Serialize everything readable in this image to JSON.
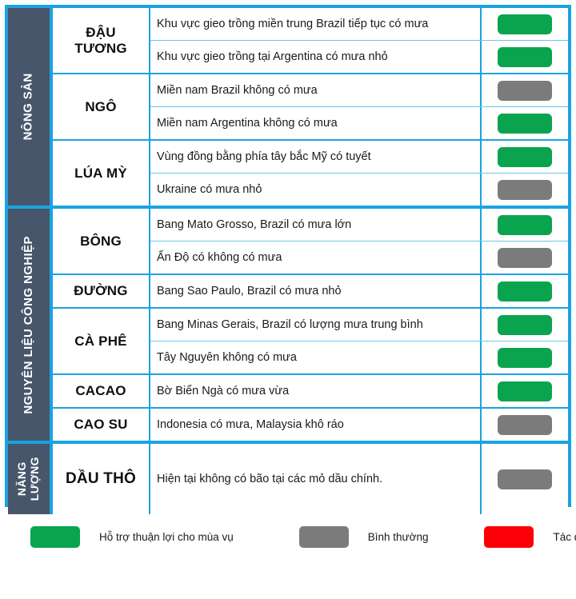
{
  "colors": {
    "border_blue": "#1aa3e0",
    "row_divider": "#6ec6ea",
    "sidebar_slate": "#47566b",
    "status_good": "#0aa44e",
    "status_neutral": "#7b7b7b",
    "status_bad": "#fb0007",
    "page_bg": "#ffffff"
  },
  "sections": [
    {
      "category": "NÔNG SẢN",
      "groups": [
        {
          "commodity": "ĐẬU\nTƯƠNG",
          "rows": [
            {
              "note": "Khu vực gieo trồng miền trung  Brazil tiếp tục có mưa",
              "status": "good",
              "status_name": "status-chip-good"
            },
            {
              "note": "Khu vực gieo trồng tại Argentina có mưa nhỏ",
              "status": "good",
              "status_name": "status-chip-good"
            }
          ]
        },
        {
          "commodity": "NGÔ",
          "rows": [
            {
              "note": "Miền nam Brazil không có mưa",
              "status": "neutral",
              "status_name": "status-chip-neutral"
            },
            {
              "note": "Miền nam Argentina không có mưa",
              "status": "good",
              "status_name": "status-chip-good"
            }
          ]
        },
        {
          "commodity": "LÚA MỲ",
          "rows": [
            {
              "note": "Vùng đồng bằng phía tây bắc Mỹ có tuyết",
              "status": "good",
              "status_name": "status-chip-good"
            },
            {
              "note": "Ukraine có mưa nhỏ",
              "status": "neutral",
              "status_name": "status-chip-neutral"
            }
          ]
        }
      ]
    },
    {
      "category": "NGUYÊN LIỆU CÔNG NGHIỆP",
      "groups": [
        {
          "commodity": "BÔNG",
          "rows": [
            {
              "note": "Bang Mato Grosso, Brazil có mưa lớn",
              "status": "good",
              "status_name": "status-chip-good"
            },
            {
              "note": "Ấn Độ có không có mưa",
              "status": "neutral",
              "status_name": "status-chip-neutral"
            }
          ]
        },
        {
          "commodity": "ĐƯỜNG",
          "rows": [
            {
              "note": "Bang Sao Paulo, Brazil có mưa nhỏ",
              "status": "good",
              "status_name": "status-chip-good"
            }
          ]
        },
        {
          "commodity": "CÀ PHÊ",
          "rows": [
            {
              "note": "Bang Minas Gerais, Brazil có lượng mưa trung  bình",
              "status": "good",
              "status_name": "status-chip-good"
            },
            {
              "note": "Tây Nguyên không có mưa",
              "status": "good",
              "status_name": "status-chip-good"
            }
          ]
        },
        {
          "commodity": "CACAO",
          "rows": [
            {
              "note": "Bờ Biển Ngà có mưa vừa",
              "status": "good",
              "status_name": "status-chip-good"
            }
          ]
        },
        {
          "commodity": "CAO SU",
          "rows": [
            {
              "note": "Indonesia có mưa, Malaysia khô ráo",
              "status": "neutral",
              "status_name": "status-chip-neutral"
            }
          ]
        }
      ]
    },
    {
      "category": "NĂNG\nLƯỢNG",
      "groups": [
        {
          "commodity": "DẦU  THÔ",
          "rows": [
            {
              "note": "Hiện tại không có bão tại các mỏ dầu chính.",
              "status": "neutral",
              "status_name": "status-chip-neutral"
            }
          ]
        }
      ]
    }
  ],
  "legend": [
    {
      "label": "Hỗ trợ thuận lợi cho mùa vụ",
      "color": "#0aa44e",
      "swatch_name": "legend-swatch-good"
    },
    {
      "label": "Bình thường",
      "color": "#7b7b7b",
      "swatch_name": "legend-swatch-neutral"
    },
    {
      "label": "Tác động bất lợi đến mùa vụ",
      "color": "#fb0007",
      "swatch_name": "legend-swatch-bad"
    }
  ]
}
